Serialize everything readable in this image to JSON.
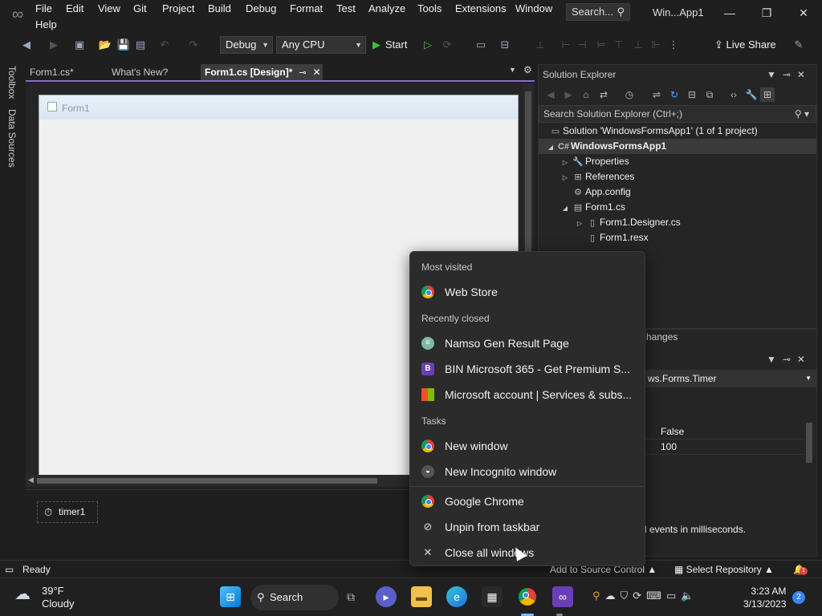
{
  "titlebar": {
    "menu": [
      "File",
      "Edit",
      "View",
      "Git",
      "Project",
      "Build",
      "Debug",
      "Format",
      "Test",
      "Analyze",
      "Tools",
      "Extensions",
      "Window",
      "Help"
    ],
    "search_label": "Search...",
    "window_title": "Win...App1"
  },
  "toolbar": {
    "config": "Debug",
    "platform": "Any CPU",
    "start_label": "Start",
    "live_share": "Live Share"
  },
  "left_rail": {
    "toolbox": "Toolbox",
    "data_sources": "Data Sources"
  },
  "doc_tabs": [
    {
      "label": "Form1.cs*"
    },
    {
      "label": "What's New?"
    },
    {
      "label": "Form1.cs [Design]*"
    }
  ],
  "designer": {
    "form_title": "Form1",
    "tray_component": "timer1"
  },
  "solution_explorer": {
    "title": "Solution Explorer",
    "search_placeholder": "Search Solution Explorer (Ctrl+;)",
    "tree": [
      {
        "label": "Solution 'WindowsFormsApp1' (1 of 1 project)",
        "icon": "solution-icon"
      },
      {
        "label": "WindowsFormsApp1",
        "icon": "csharp-project-icon"
      },
      {
        "label": "Properties",
        "icon": "wrench-icon"
      },
      {
        "label": "References",
        "icon": "references-icon"
      },
      {
        "label": "App.config",
        "icon": "config-icon"
      },
      {
        "label": "Form1.cs",
        "icon": "form-icon"
      },
      {
        "label": "Form1.Designer.cs",
        "icon": "file-icon"
      },
      {
        "label": "Form1.resx",
        "icon": "file-icon"
      }
    ]
  },
  "properties": {
    "tab_partial": "hanges",
    "object_type": "ws.Forms.Timer",
    "rows": [
      {
        "value": "False"
      },
      {
        "value": "100"
      }
    ],
    "description": "d events in milliseconds."
  },
  "jumplist": {
    "most_visited_header": "Most visited",
    "most_visited": [
      {
        "label": "Web Store",
        "icon": "chrome-icon"
      }
    ],
    "recently_closed_header": "Recently closed",
    "recently_closed": [
      {
        "label": "Namso Gen Result Page",
        "icon": "namso-icon"
      },
      {
        "label": "BIN Microsoft 365 - Get Premium S...",
        "icon": "b-icon"
      },
      {
        "label": "Microsoft account | Services & subs...",
        "icon": "microsoft-icon"
      }
    ],
    "tasks_header": "Tasks",
    "tasks": [
      {
        "label": "New window",
        "icon": "chrome-icon"
      },
      {
        "label": "New Incognito window",
        "icon": "incognito-icon"
      }
    ],
    "app_actions": [
      {
        "label": "Google Chrome",
        "icon": "chrome-icon"
      },
      {
        "label": "Unpin from taskbar",
        "icon": "unpin-icon"
      },
      {
        "label": "Close all windows",
        "icon": "close-icon"
      }
    ]
  },
  "statusbar": {
    "ready": "Ready",
    "source_control": "Add to Source Control",
    "repository": "Select Repository",
    "notifications": "1"
  },
  "taskbar": {
    "temperature": "39°F",
    "condition": "Cloudy",
    "search_label": "Search",
    "time": "3:23 AM",
    "date": "3/13/2023",
    "notification_count": "2"
  },
  "colors": {
    "accent": "#8d6ad9",
    "background": "#1f1f1f",
    "panel": "#252526",
    "jumplist_bg": "#2b2b2b"
  }
}
